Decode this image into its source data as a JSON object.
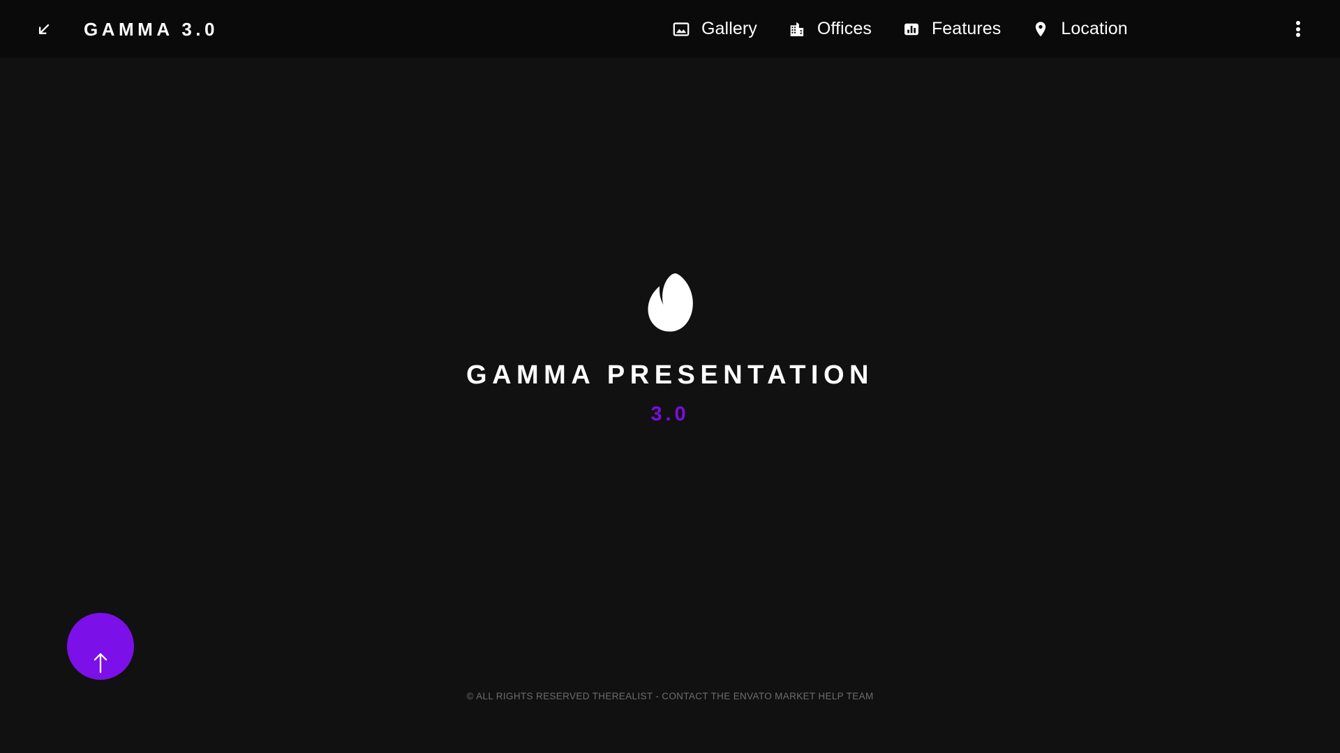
{
  "theme": {
    "background": "#111111",
    "header_background": "#0a0a0a",
    "accent_purple": "#7b0ce0",
    "button_purple": "#7b10e8",
    "text_primary": "#ffffff",
    "text_muted": "#6d6d6d"
  },
  "header": {
    "brand_icon": "arrow-down-left-icon",
    "brand_title": "GAMMA 3.0",
    "nav_items": [
      {
        "label": "Gallery",
        "icon": "image-icon"
      },
      {
        "label": "Offices",
        "icon": "building-icon"
      },
      {
        "label": "Features",
        "icon": "bar-chart-icon"
      },
      {
        "label": "Location",
        "icon": "map-pin-icon"
      }
    ],
    "overflow_icon": "more-vertical-icon"
  },
  "hero": {
    "logo_icon": "envato-leaf-icon",
    "title": "GAMMA PRESENTATION",
    "version": "3.0"
  },
  "scroll_top": {
    "icon": "arrow-up-icon",
    "aria_label": "Scroll to top"
  },
  "footer": {
    "text": "© ALL RIGHTS RESERVED THEREALIST  - CONTACT THE ENVATO MARKET HELP TEAM"
  }
}
